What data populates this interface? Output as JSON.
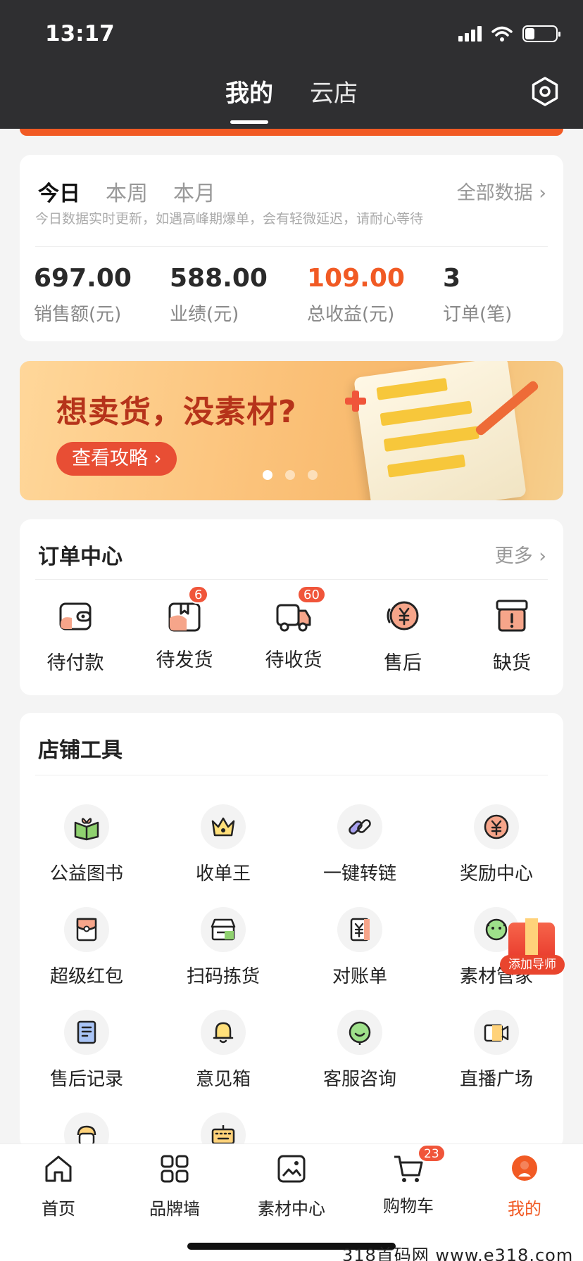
{
  "status_bar": {
    "time": "13:17"
  },
  "top_nav": {
    "tabs": [
      {
        "label": "我的"
      },
      {
        "label": "云店"
      }
    ]
  },
  "stats": {
    "tabs": [
      {
        "label": "今日"
      },
      {
        "label": "本周"
      },
      {
        "label": "本月"
      }
    ],
    "all_data": "全部数据 ›",
    "note": "今日数据实时更新，如遇高峰期爆单，会有轻微延迟，请耐心等待",
    "items": [
      {
        "value": "697.00",
        "label": "销售额(元)"
      },
      {
        "value": "588.00",
        "label": "业绩(元)"
      },
      {
        "value": "109.00",
        "label": "总收益(元)"
      },
      {
        "value": "3",
        "label": "订单(笔)"
      }
    ]
  },
  "banner": {
    "title": "想卖货，没素材?",
    "cta": "查看攻略 ›"
  },
  "orders": {
    "title": "订单中心",
    "more": "更多 ›",
    "items": [
      {
        "label": "待付款",
        "icon": "wallet-icon"
      },
      {
        "label": "待发货",
        "icon": "package-icon",
        "badge": "6"
      },
      {
        "label": "待收货",
        "icon": "truck-icon",
        "badge": "60"
      },
      {
        "label": "售后",
        "icon": "yuan-refund-icon"
      },
      {
        "label": "缺货",
        "icon": "out-of-stock-icon"
      }
    ]
  },
  "tools": {
    "title": "店铺工具",
    "items": [
      {
        "label": "公益图书",
        "icon": "book-icon"
      },
      {
        "label": "收单王",
        "icon": "crown-icon"
      },
      {
        "label": "一键转链",
        "icon": "link-icon"
      },
      {
        "label": "奖励中心",
        "icon": "reward-icon"
      },
      {
        "label": "超级红包",
        "icon": "red-packet-icon"
      },
      {
        "label": "扫码拣货",
        "icon": "scan-box-icon"
      },
      {
        "label": "对账单",
        "icon": "bill-icon"
      },
      {
        "label": "素材管家",
        "icon": "material-manager-icon"
      },
      {
        "label": "售后记录",
        "icon": "record-icon"
      },
      {
        "label": "意见箱",
        "icon": "bell-icon"
      },
      {
        "label": "客服咨询",
        "icon": "customer-service-icon"
      },
      {
        "label": "直播广场",
        "icon": "live-camera-icon"
      },
      {
        "label": "",
        "icon": "avatar-tool-icon"
      },
      {
        "label": "",
        "icon": "keyboard-icon"
      }
    ]
  },
  "float_button": {
    "label": "添加导师"
  },
  "bottom_nav": {
    "items": [
      {
        "label": "首页",
        "icon": "home-icon"
      },
      {
        "label": "品牌墙",
        "icon": "grid-icon"
      },
      {
        "label": "素材中心",
        "icon": "image-icon"
      },
      {
        "label": "购物车",
        "icon": "cart-icon",
        "badge": "23"
      },
      {
        "label": "我的",
        "icon": "profile-icon"
      }
    ]
  },
  "watermark": "318首码网  www.e318.com",
  "colors": {
    "accent": "#f15a24",
    "header_bg": "#2f2f31",
    "badge": "#f0553a"
  }
}
